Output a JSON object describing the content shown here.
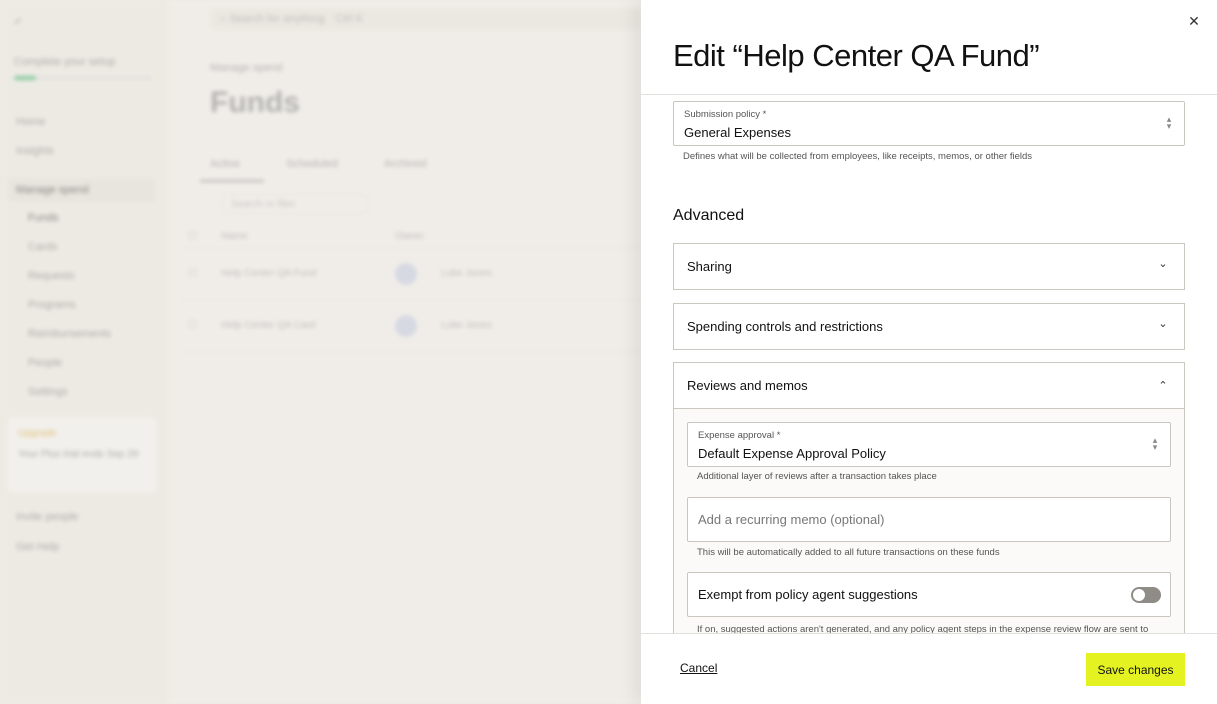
{
  "background": {
    "setup_label": "Complete your setup",
    "nav": [
      {
        "label": "Home"
      },
      {
        "label": "Insights"
      },
      {
        "label": "Manage spend"
      },
      {
        "label": "Funds"
      },
      {
        "label": "Cards"
      },
      {
        "label": "Requests"
      },
      {
        "label": "Programs"
      },
      {
        "label": "Reimbursements"
      },
      {
        "label": "People"
      },
      {
        "label": "Settings"
      }
    ],
    "promo_tag": "Upgrade",
    "promo_text": "Your Plus trial ends Sep 29",
    "nav_bottom": [
      {
        "label": "Invite people"
      },
      {
        "label": "Get Help"
      }
    ],
    "search_placeholder": "Search for anything",
    "search_shortcut": "Ctrl K",
    "breadcrumb": "Manage spend",
    "page_title": "Funds",
    "tabs": [
      "Active",
      "Scheduled",
      "Archived"
    ],
    "filter_placeholder": "Search or filter",
    "table_headers": [
      "Name",
      "Owner"
    ],
    "rows": [
      {
        "name": "Help Center QA Fund",
        "owner": "Luke Jones"
      },
      {
        "name": "Help Center QA Card",
        "owner": "Luke Jones"
      }
    ]
  },
  "drawer": {
    "title": "Edit “Help Center QA Fund”",
    "submission_policy": {
      "label": "Submission policy *",
      "value": "General Expenses",
      "help": "Defines what will be collected from employees, like receipts, memos, or other fields"
    },
    "advanced_heading": "Advanced",
    "sections": [
      {
        "label": "Sharing",
        "state": "collapsed"
      },
      {
        "label": "Spending controls and restrictions",
        "state": "collapsed"
      },
      {
        "label": "Reviews and memos",
        "state": "expanded"
      }
    ],
    "expense_approval": {
      "label": "Expense approval *",
      "value": "Default Expense Approval Policy",
      "help": "Additional layer of reviews after a transaction takes place"
    },
    "memo": {
      "placeholder": "Add a recurring memo (optional)",
      "help": "This will be automatically added to all future transactions on these funds"
    },
    "exempt": {
      "label": "Exempt from policy agent suggestions",
      "enabled": false,
      "help": "If on, suggested actions aren't generated, and any policy agent steps in the expense review flow are sent to"
    },
    "cancel_label": "Cancel",
    "save_label": "Save changes"
  },
  "colors": {
    "accent": "#e4f222",
    "toggle_off": "#8f8b86"
  }
}
